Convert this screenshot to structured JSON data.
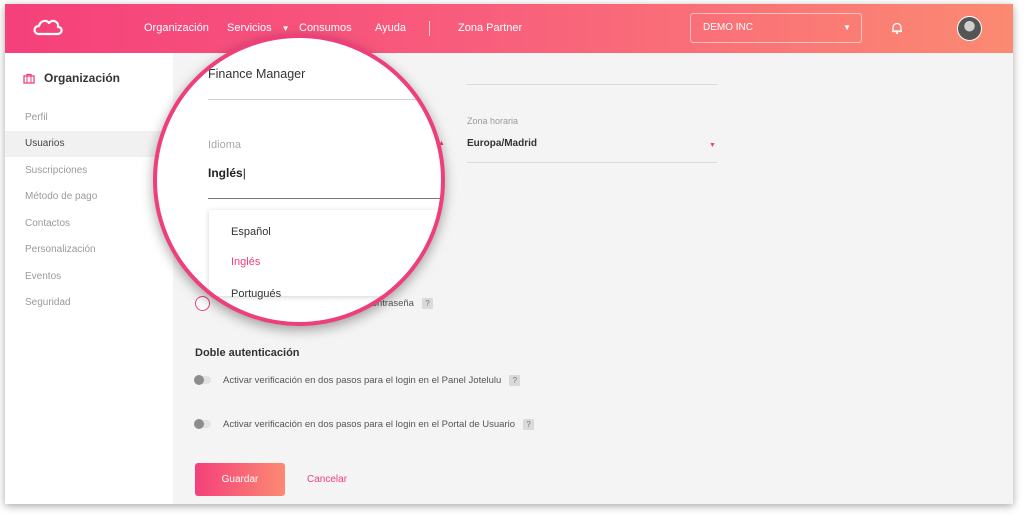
{
  "topbar": {
    "nav": [
      "Organización",
      "Servicios",
      "Consumos",
      "Ayuda",
      "Zona Partner"
    ],
    "company": "DEMO INC"
  },
  "sidebar": {
    "title": "Organización",
    "items": [
      {
        "label": "Perfil"
      },
      {
        "label": "Usuarios"
      },
      {
        "label": "Suscripciones"
      },
      {
        "label": "Método de pago"
      },
      {
        "label": "Contactos"
      },
      {
        "label": "Personalización"
      },
      {
        "label": "Eventos"
      },
      {
        "label": "Seguridad"
      }
    ]
  },
  "form": {
    "timezone_label": "Zona horaria",
    "timezone_value": "Europa/Madrid",
    "password_text": "eva contraseña",
    "two_factor_title": "Doble autenticación",
    "toggle_panel": "Activar verificación en dos pasos para el login en el Panel Jotelulu",
    "toggle_portal": "Activar verificación en dos pasos para el login en el Portal de Usuario",
    "help": "?",
    "save": "Guardar",
    "cancel": "Cancelar"
  },
  "magnifier": {
    "cut_label": "Fi",
    "role_value": "Finance Manager",
    "language_label": "Idioma",
    "language_value": "Inglés",
    "options": [
      "Español",
      "Inglés",
      "Portugués"
    ],
    "selected_option": "Inglés"
  },
  "colors": {
    "accent": "#f0407a",
    "gradient_start": "#f5407b",
    "gradient_end": "#fb8a72"
  }
}
